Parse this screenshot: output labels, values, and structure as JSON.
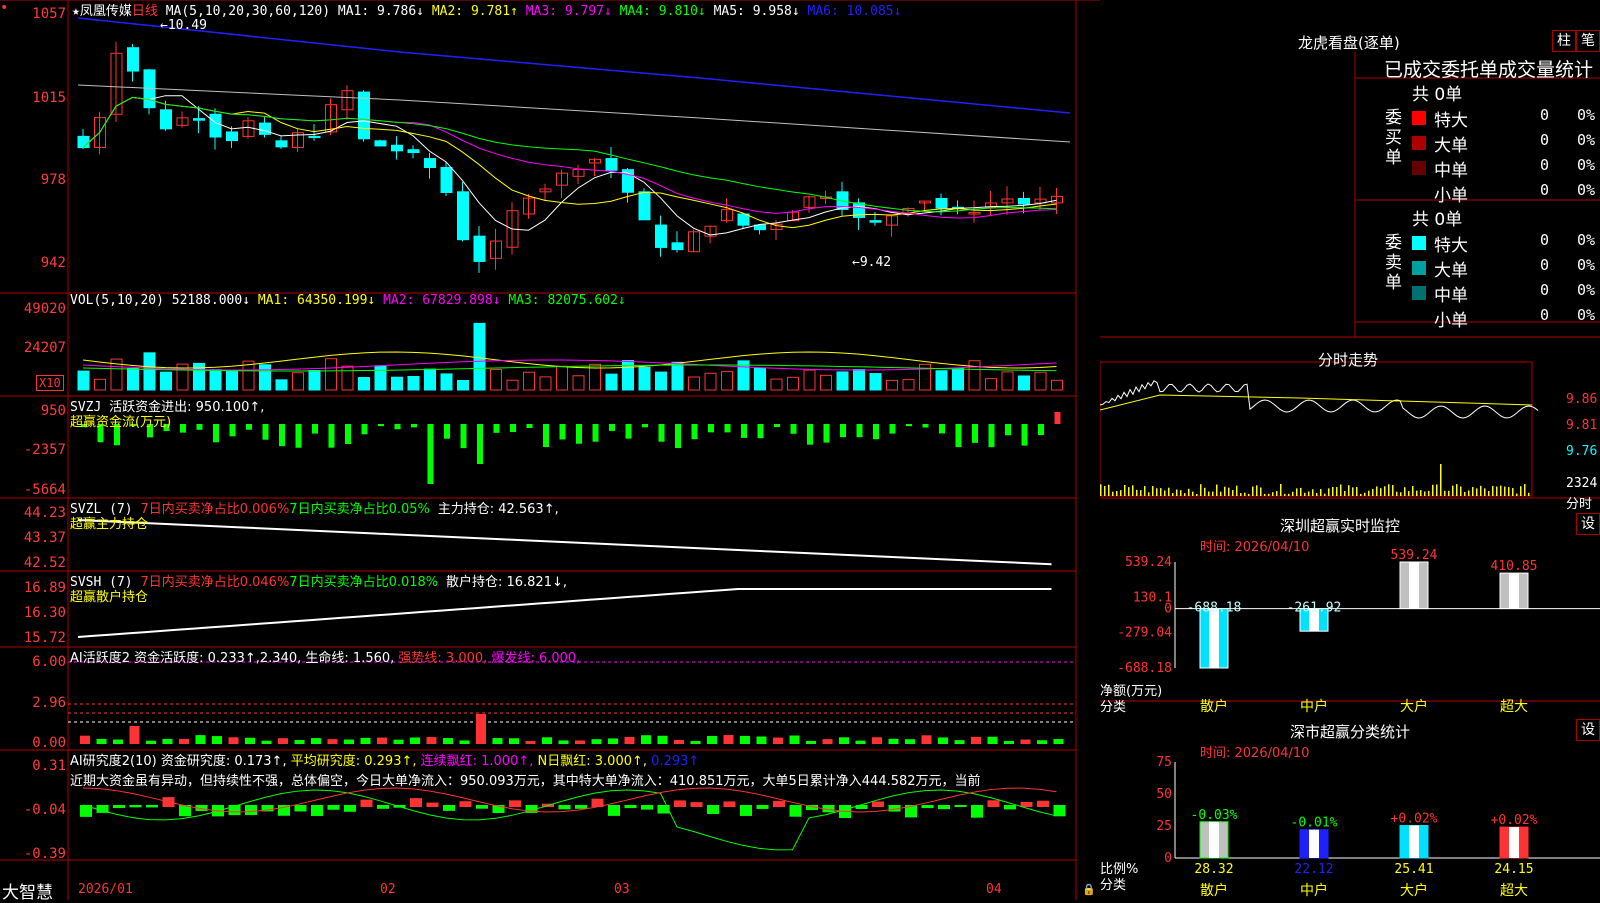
{
  "stock": {
    "star": "★",
    "name": "凤凰传媒",
    "period": "日线",
    "ma_header": "MA(5,10,20,30,60,120)",
    "ma1": "MA1: 9.786↓",
    "ma2": "MA2: 9.781↑",
    "ma3": "MA3: 9.797↓",
    "ma4": "MA4: 9.810↓",
    "ma5": "MA5: 9.958↓",
    "ma6": "MA6: 10.085↓",
    "hi_mark": "10.49",
    "lo_mark": "9.42",
    "y_labels": [
      "1057",
      "1015",
      "978",
      "942"
    ]
  },
  "colors": {
    "bg": "#000000",
    "grid": "#b00000",
    "up": "#ff3333",
    "down": "#00ffff",
    "green": "#00ff00",
    "yellow": "#ffff00",
    "magenta": "#ff00ff",
    "blue": "#2020ff",
    "white": "#ffffff"
  },
  "vol": {
    "header": "VOL(5,10,20)",
    "value": "52188.000↓",
    "ma1": "MA1: 64350.199↓",
    "ma2": "MA2: 67829.898↓",
    "ma3": "MA3: 82075.602↓",
    "y_labels": [
      "49020",
      "24207"
    ],
    "unit": "X10"
  },
  "svzj": {
    "header": "SVZJ",
    "text": "活跃资金进出: 950.100↑,",
    "sub": "超赢资金流(万元)",
    "y_labels": [
      "950",
      "-2357",
      "-5664"
    ]
  },
  "svzl": {
    "header": "SVZL (7)",
    "t1": "7日内买卖净占比0.006%",
    "t2": "7日内买卖净占比0.05%",
    "t3": "主力持仓: 42.563↑,",
    "sub": "超赢主力持仓",
    "y_labels": [
      "44.23",
      "43.37",
      "42.52"
    ]
  },
  "svsh": {
    "header": "SVSH (7)",
    "t1": "7日内买卖净占比0.046%",
    "t2": "7日内买卖净占比0.018%",
    "t3": "散户持仓: 16.821↓,",
    "sub": "超赢散户持仓",
    "y_labels": [
      "16.89",
      "16.30",
      "15.72"
    ]
  },
  "ai1": {
    "header": "AI活跃度2",
    "t1": "资金活跃度: 0.233↑,",
    "t2": "2.340,",
    "t3": "生命线: 1.560,",
    "t4": "强势线: 3.000,",
    "t5": "爆发线: 6.000,",
    "y_labels": [
      "6.00",
      "2.96",
      "0.00"
    ]
  },
  "ai2": {
    "header": "AI研究度2(10)",
    "t1": "资金研究度: 0.173↑,",
    "t2": "平均研究度: 0.293↑,",
    "t3": "连续飘红: 1.000↑,",
    "t4": "N日飘红: 3.000↑,",
    "t5": "0.293↑",
    "comment": "近期大资金虽有异动，但持续性不强，总体偏空，今日大单净流入：950.093万元，其中特大单净流入：410.851万元，大单5日累计净入444.582万元，当前",
    "y_labels": [
      "0.31",
      "-0.04",
      "-0.39"
    ]
  },
  "xaxis": {
    "brand": "大智慧",
    "labels": [
      "2026/01",
      "02",
      "03",
      "04"
    ]
  },
  "lhb": {
    "title": "龙虎看盘(逐单)",
    "btn1": "柱",
    "btn2": "笔",
    "stat_title": "已成交委托单成交量统计",
    "buy_label": "委买单",
    "sell_label": "委卖单",
    "buy_total": "共 0单",
    "sell_total": "共 0单",
    "buy_rows": [
      {
        "label": "特大",
        "count": "0",
        "pct": "0%",
        "color": "#ff0000"
      },
      {
        "label": "大单",
        "count": "0",
        "pct": "0%",
        "color": "#aa0000"
      },
      {
        "label": "中单",
        "count": "0",
        "pct": "0%",
        "color": "#660000"
      },
      {
        "label": "小单",
        "count": "0",
        "pct": "0%",
        "color": ""
      }
    ],
    "sell_rows": [
      {
        "label": "特大",
        "count": "0",
        "pct": "0%",
        "color": "#00ffff"
      },
      {
        "label": "大单",
        "count": "0",
        "pct": "0%",
        "color": "#00a0a0"
      },
      {
        "label": "中单",
        "count": "0",
        "pct": "0%",
        "color": "#007070"
      },
      {
        "label": "小单",
        "count": "0",
        "pct": "0%",
        "color": ""
      }
    ]
  },
  "intraday": {
    "title": "分时走势",
    "prices": [
      "9.86",
      "9.81",
      "9.76"
    ],
    "vol_top": "2324",
    "vol_unit": "分时"
  },
  "sz_monitor": {
    "title": "深圳超赢实时监控",
    "btn": "设",
    "time": "时间: 2026/04/10",
    "y_labels": [
      "539.24",
      "130.1",
      "0",
      "-279.04",
      "-688.18"
    ],
    "ylabel1": "净额(万元)",
    "ylabel2": "分类",
    "bars": [
      {
        "cat": "散户",
        "value": -688.18,
        "label": "-688.18"
      },
      {
        "cat": "中户",
        "value": -261.92,
        "label": "-261.92"
      },
      {
        "cat": "大户",
        "value": 539.24,
        "label": "539.24"
      },
      {
        "cat": "超大",
        "value": 410.85,
        "label": "410.85"
      }
    ]
  },
  "sh_stats": {
    "title": "深市超赢分类统计",
    "btn": "设",
    "time": "时间: 2026/04/10",
    "y_labels": [
      "75",
      "50",
      "25",
      "0"
    ],
    "ylabel1": "比例%",
    "ylabel2": "分类",
    "bars": [
      {
        "cat": "散户",
        "value": 28.32,
        "label": "28.32",
        "change": "-0.03%"
      },
      {
        "cat": "中户",
        "value": 22.12,
        "label": "22.12",
        "change": "-0.01%"
      },
      {
        "cat": "大户",
        "value": 25.41,
        "label": "25.41",
        "change": "+0.02%"
      },
      {
        "cat": "超大",
        "value": 24.15,
        "label": "24.15",
        "change": "+0.02%"
      }
    ]
  },
  "chart_data": [
    {
      "type": "bar",
      "categories": [
        "散户",
        "中户",
        "大户",
        "超大"
      ],
      "values": [
        -688.18,
        -261.92,
        539.24,
        410.85
      ],
      "title": "深圳超赢实时监控",
      "ylabel": "净额(万元)",
      "xlabel": "分类",
      "ylim": [
        -688.18,
        539.24
      ]
    },
    {
      "type": "bar",
      "categories": [
        "散户",
        "中户",
        "大户",
        "超大"
      ],
      "values": [
        28.32,
        22.12,
        25.41,
        24.15
      ],
      "title": "深市超赢分类统计",
      "ylabel": "比例%",
      "xlabel": "分类",
      "ylim": [
        0,
        75
      ]
    }
  ]
}
